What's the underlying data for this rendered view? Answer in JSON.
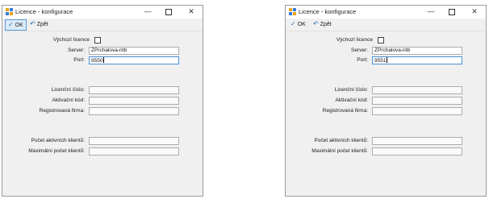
{
  "windows": [
    {
      "title": "Licence - konfigurace",
      "toolbar": {
        "ok_label": "OK",
        "back_label": "Zpět"
      },
      "checkbox_label": "Výchozí licence",
      "fields": {
        "server": {
          "label": "Server:",
          "value": "ZPrchalova-ntb"
        },
        "port": {
          "label": "Port:",
          "value": "9550"
        },
        "license_number": {
          "label": "Licenční číslo:",
          "value": ""
        },
        "activation_code": {
          "label": "Aktivační kód:",
          "value": ""
        },
        "registered_company": {
          "label": "Registrovaná firma:",
          "value": ""
        },
        "active_clients": {
          "label": "Počet aktivních klientů:",
          "value": ""
        },
        "max_clients": {
          "label": "Maximální počet klientů:",
          "value": ""
        }
      }
    },
    {
      "title": "Licence - konfigurace",
      "toolbar": {
        "ok_label": "OK",
        "back_label": "Zpět"
      },
      "checkbox_label": "Výchozí licence",
      "fields": {
        "server": {
          "label": "Server:",
          "value": "ZPrchalova-ntb"
        },
        "port": {
          "label": "Port:",
          "value": "9551"
        },
        "license_number": {
          "label": "Licenční číslo:",
          "value": ""
        },
        "activation_code": {
          "label": "Aktivační kód:",
          "value": ""
        },
        "registered_company": {
          "label": "Registrovaná firma:",
          "value": ""
        },
        "active_clients": {
          "label": "Počet aktivních klientů:",
          "value": ""
        },
        "max_clients": {
          "label": "Maximální počet klientů:",
          "value": ""
        }
      }
    }
  ],
  "icons": {
    "minimize": "—",
    "close": "✕",
    "ok": "✓",
    "back": "↶"
  }
}
